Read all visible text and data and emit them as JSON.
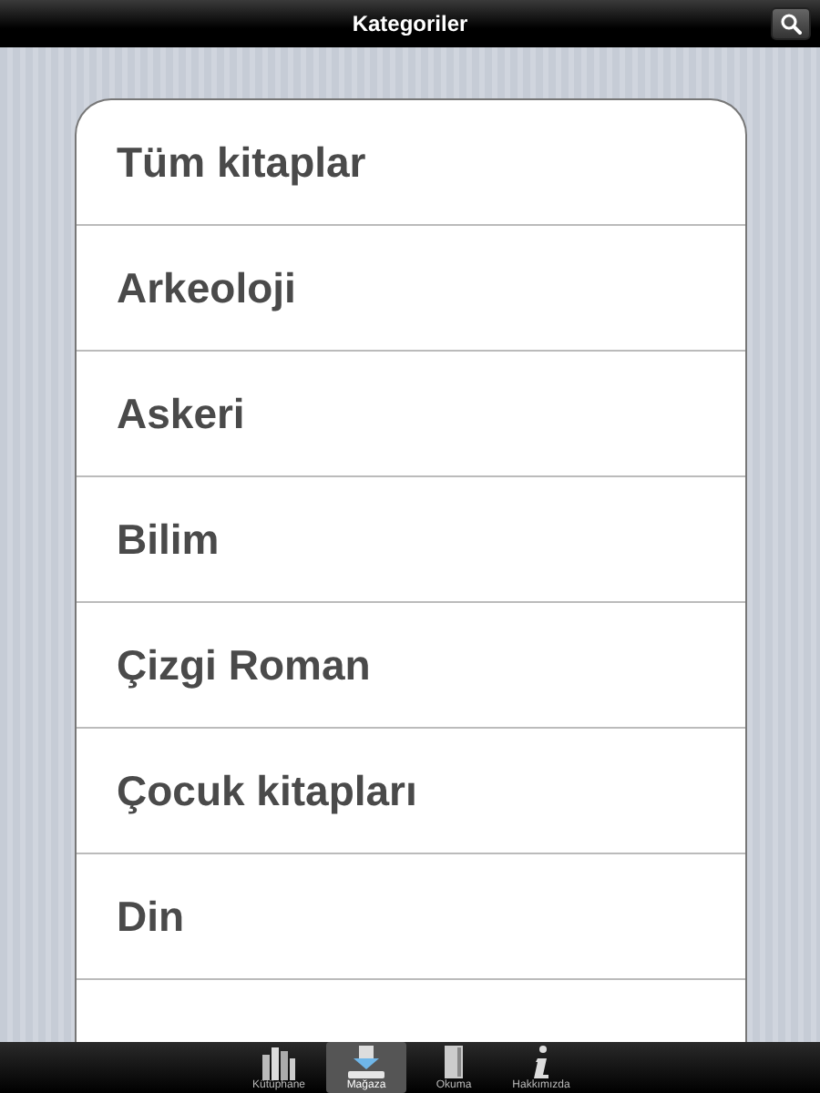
{
  "navigation_bar": {
    "title": "Kategoriler"
  },
  "categories": [
    {
      "label": "Tüm kitaplar"
    },
    {
      "label": "Arkeoloji"
    },
    {
      "label": "Askeri"
    },
    {
      "label": "Bilim"
    },
    {
      "label": "Çizgi Roman"
    },
    {
      "label": "Çocuk kitapları"
    },
    {
      "label": "Din"
    }
  ],
  "tab_bar": [
    {
      "label": "Kütüphane",
      "kind": "library",
      "selected": false
    },
    {
      "label": "Mağaza",
      "kind": "store",
      "selected": true
    },
    {
      "label": "Okuma",
      "kind": "reading",
      "selected": false
    },
    {
      "label": "Hakkımızda",
      "kind": "about",
      "selected": false
    }
  ]
}
